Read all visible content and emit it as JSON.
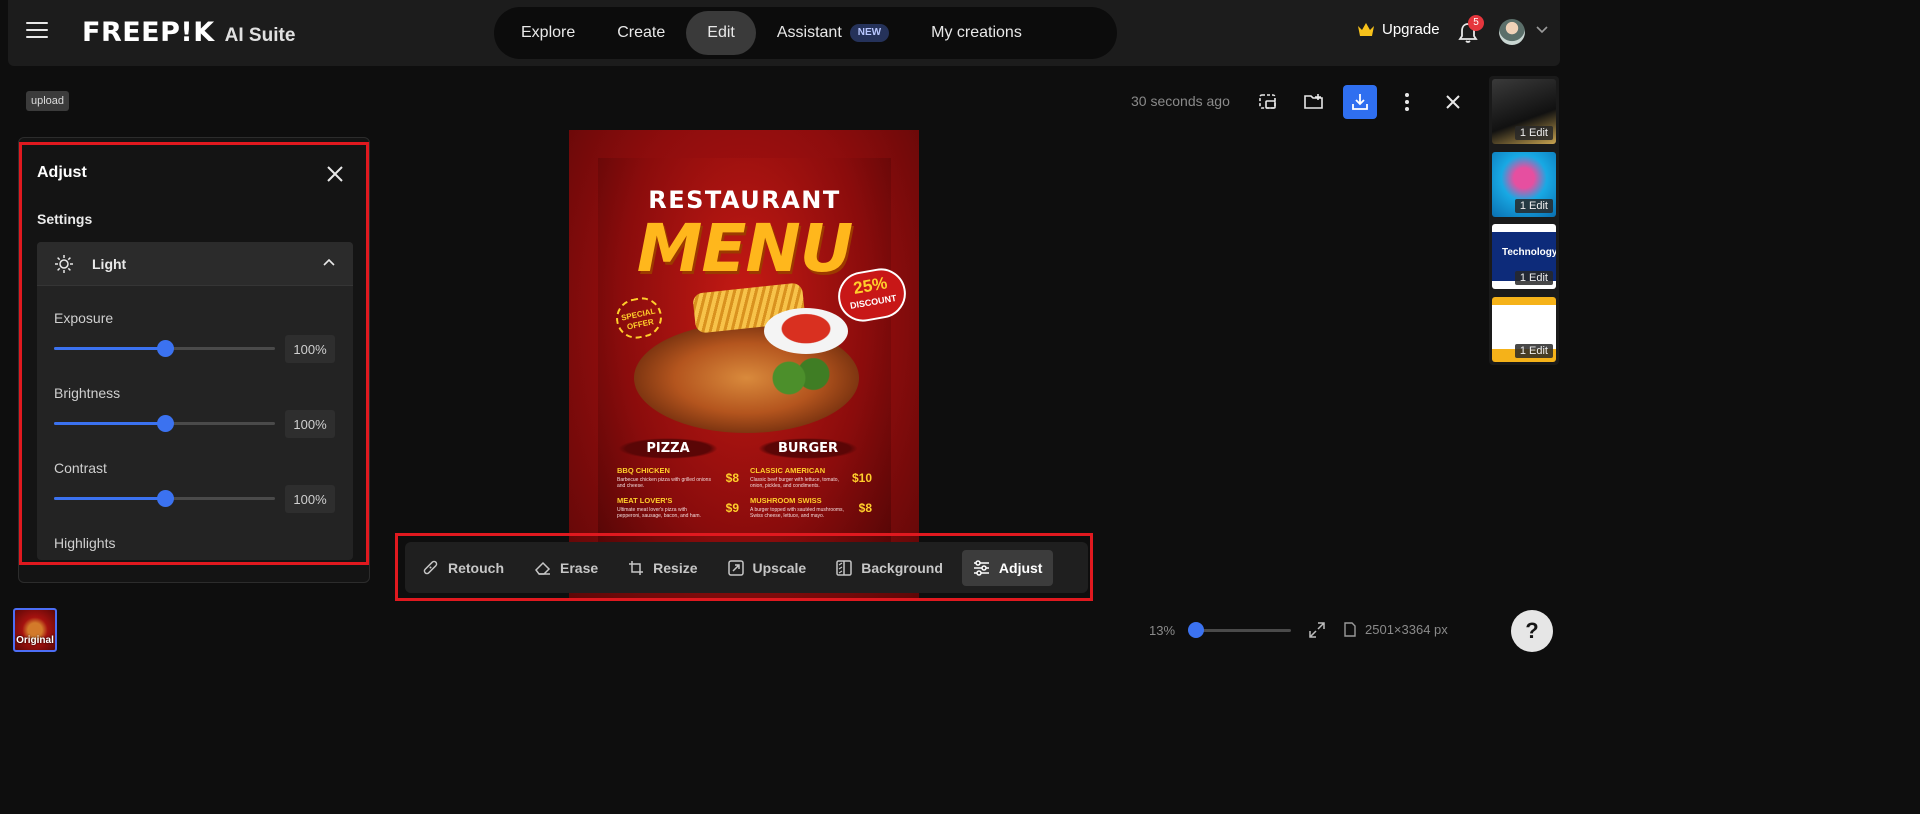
{
  "header": {
    "logo_word": "FREEP!K",
    "logo_suite": "AI Suite",
    "nav": [
      {
        "label": "Explore"
      },
      {
        "label": "Create"
      },
      {
        "label": "Edit"
      },
      {
        "label": "Assistant",
        "badge": "NEW"
      },
      {
        "label": "My creations"
      }
    ],
    "active_nav": "Edit",
    "upgrade_label": "Upgrade",
    "notification_count": "5",
    "icons": [
      "menu-icon",
      "crown-icon",
      "bell-icon",
      "chevron-down-icon"
    ]
  },
  "subbar": {
    "upload_tag": "upload",
    "timestamp": "30 seconds ago",
    "icons": [
      "add-to-canvas-icon",
      "add-to-folder-icon",
      "download-icon",
      "more-vertical-icon",
      "close-icon"
    ]
  },
  "adjust": {
    "title": "Adjust",
    "settings_label": "Settings",
    "group_label": "Light",
    "settings": [
      {
        "label": "Exposure",
        "value": "100",
        "unit": "%",
        "slider_fraction": 0.5
      },
      {
        "label": "Brightness",
        "value": "100",
        "unit": "%",
        "slider_fraction": 0.5
      },
      {
        "label": "Contrast",
        "value": "100",
        "unit": "%",
        "slider_fraction": 0.5
      },
      {
        "label": "Highlights",
        "value": "",
        "unit": "",
        "slider_fraction": 0.5
      }
    ]
  },
  "poster": {
    "title_line1": "RESTAURANT",
    "title_line2": "MENU",
    "discount_value": "25%",
    "discount_label": "DISCOUNT",
    "special_line1": "SPECIAL",
    "special_line2": "OFFER",
    "category_left": "PIZZA",
    "category_right": "BURGER",
    "left_items": [
      {
        "name": "BBQ CHICKEN",
        "desc": "Barbecue chicken pizza with grilled onions and cheese.",
        "price": "$8"
      },
      {
        "name": "MEAT LOVER'S",
        "desc": "Ultimate meat lover's pizza with pepperoni, sausage, bacon, and ham.",
        "price": "$9"
      }
    ],
    "right_items": [
      {
        "name": "CLASSIC AMERICAN",
        "desc": "Classic beef burger with lettuce, tomato, onion, pickles, and condiments.",
        "price": "$10"
      },
      {
        "name": "MUSHROOM SWISS",
        "desc": "A burger topped with sautéed mushrooms, Swiss cheese, lettuce, and mayo.",
        "price": "$8"
      }
    ]
  },
  "toolbar": {
    "tools": [
      {
        "label": "Retouch",
        "icon": "retouch-icon"
      },
      {
        "label": "Erase",
        "icon": "eraser-icon"
      },
      {
        "label": "Resize",
        "icon": "crop-icon"
      },
      {
        "label": "Upscale",
        "icon": "upscale-icon"
      },
      {
        "label": "Background",
        "icon": "background-icon"
      },
      {
        "label": "Adjust",
        "icon": "sliders-icon"
      }
    ],
    "active_tool": "Adjust"
  },
  "thumbnails": [
    {
      "badge": "1 Edit",
      "colors": [
        "#2b2b2b",
        "#c9a450"
      ]
    },
    {
      "badge": "1 Edit",
      "colors": [
        "#18a9e4",
        "#e64fa0"
      ]
    },
    {
      "badge": "1 Edit",
      "label": "Technology",
      "colors": [
        "#0d2b7a",
        "#ffffff"
      ]
    },
    {
      "badge": "1 Edit",
      "colors": [
        "#f5b219",
        "#ffffff"
      ]
    }
  ],
  "original_thumb_label": "Original",
  "zoom": {
    "percent": "13%",
    "fraction": 0.08
  },
  "image_dims": "2501×3364 px",
  "help_label": "?",
  "colors": {
    "accent": "#3b72f0",
    "highlight_box": "#e0191f",
    "notification": "#e5363d"
  }
}
